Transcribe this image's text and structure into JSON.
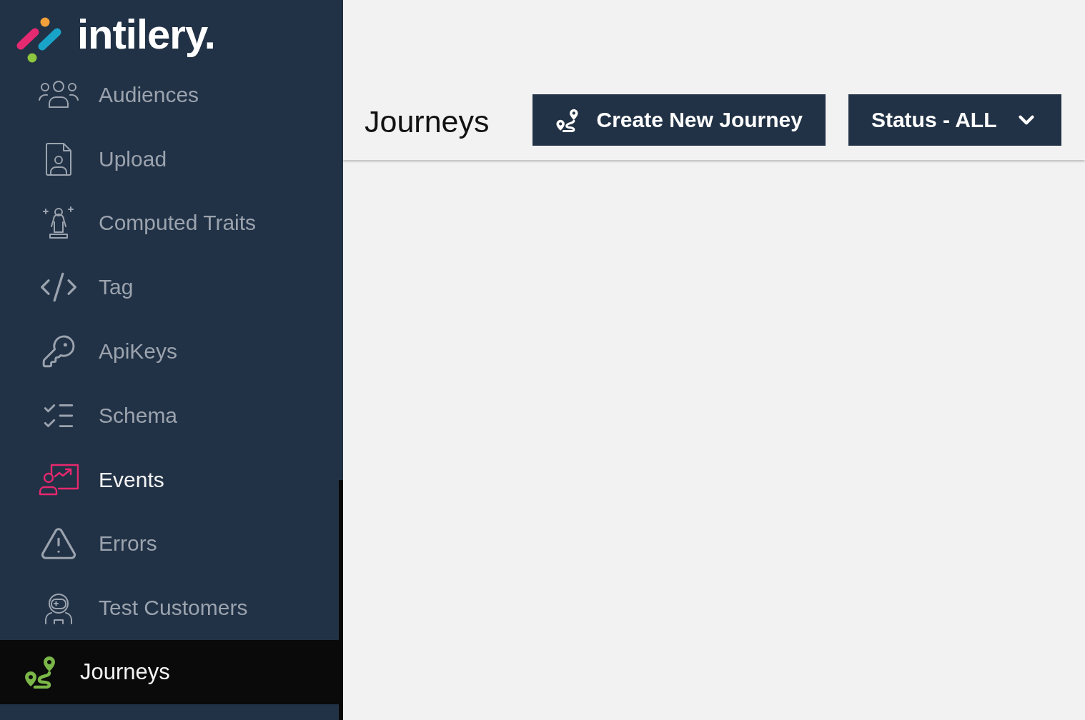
{
  "logo": {
    "text": "intilery."
  },
  "sidebar": {
    "items": [
      {
        "label": "Audiences",
        "selected": false,
        "highlighted": false
      },
      {
        "label": "Upload",
        "selected": false,
        "highlighted": false
      },
      {
        "label": "Computed Traits",
        "selected": false,
        "highlighted": false
      },
      {
        "label": "Tag",
        "selected": false,
        "highlighted": false
      },
      {
        "label": "ApiKeys",
        "selected": false,
        "highlighted": false
      },
      {
        "label": "Schema",
        "selected": false,
        "highlighted": false
      },
      {
        "label": "Events",
        "selected": false,
        "highlighted": true
      },
      {
        "label": "Errors",
        "selected": false,
        "highlighted": false
      },
      {
        "label": "Test Customers",
        "selected": false,
        "highlighted": false
      },
      {
        "label": "Journeys",
        "selected": true,
        "highlighted": false
      }
    ]
  },
  "header": {
    "title": "Journeys",
    "create_button": {
      "label": "Create New Journey"
    },
    "status_filter": {
      "label": "Status - ALL"
    }
  }
}
